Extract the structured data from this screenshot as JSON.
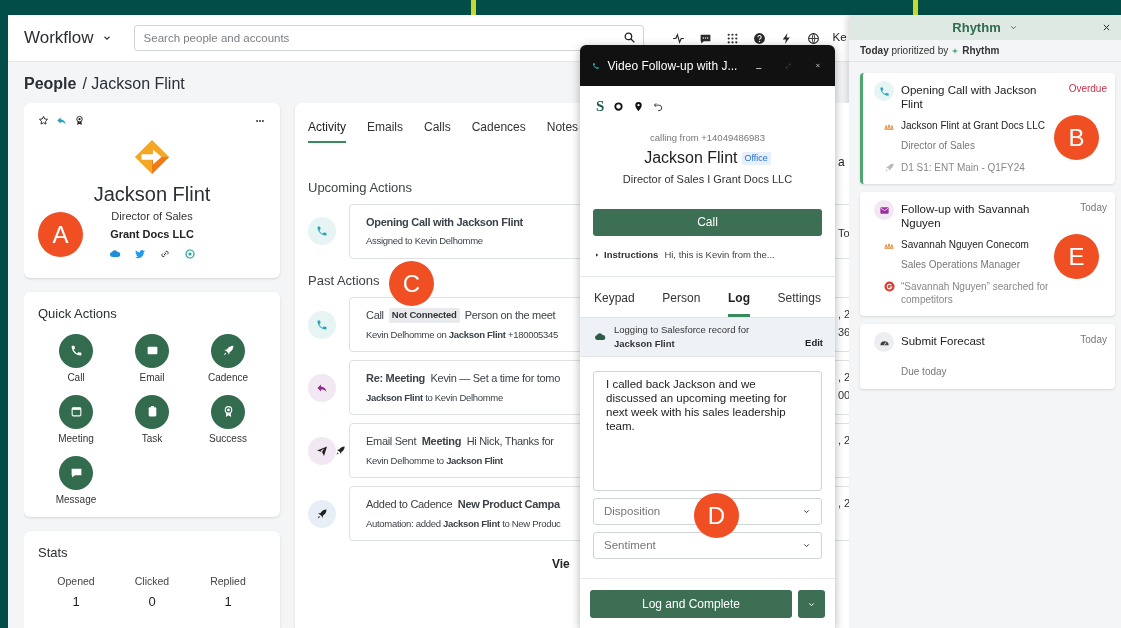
{
  "app": {
    "menu": "Workflow",
    "search": {
      "placeholder": "Search people and accounts"
    },
    "user_fragment": "Ke"
  },
  "breadcrumb": {
    "section": "People",
    "current": "/ Jackson Flint"
  },
  "profile": {
    "name": "Jackson Flint",
    "title": "Director of Sales",
    "company": "Grant Docs LLC"
  },
  "quick_actions": {
    "title": "Quick Actions",
    "items": [
      {
        "label": "Call",
        "kind": "call"
      },
      {
        "label": "Email",
        "kind": "email"
      },
      {
        "label": "Cadence",
        "kind": "cadence"
      },
      {
        "label": "Meeting",
        "kind": "meeting"
      },
      {
        "label": "Task",
        "kind": "task"
      },
      {
        "label": "Success",
        "kind": "success"
      },
      {
        "label": "Message",
        "kind": "message"
      }
    ]
  },
  "stats": {
    "title": "Stats",
    "items": [
      {
        "label": "Opened",
        "value": "1"
      },
      {
        "label": "Clicked",
        "value": "0"
      },
      {
        "label": "Replied",
        "value": "1"
      }
    ]
  },
  "activity": {
    "tabs": [
      {
        "label": "Activity",
        "selected": true
      },
      {
        "label": "Emails",
        "selected": false
      },
      {
        "label": "Calls",
        "selected": false
      },
      {
        "label": "Cadences",
        "selected": false
      },
      {
        "label": "Notes",
        "selected": false
      }
    ],
    "header_fragment": "a",
    "upcoming_title": "Upcoming Actions",
    "upcoming": [
      {
        "kind": "call",
        "line1": "**Opening Call with Jackson Flint**",
        "line2": "Assigned to Kevin Delhomme",
        "fragments": [
          "To"
        ]
      }
    ],
    "past_title": "Past Actions",
    "past": [
      {
        "kind": "call",
        "line1": "Call",
        "tag": "Not Connected",
        "line1_rest": "Person on the meet",
        "line2": "Kevin Delhomme on **Jackson Flint** +180005345",
        "fragments": [
          ", 2",
          "36"
        ]
      },
      {
        "kind": "reply",
        "line1": "**Re: Meeting**  Kevin — Set a time for tomo",
        "line2": "**Jackson Flint** to Kevin Delhomme",
        "fragments": [
          ", 2",
          "00"
        ]
      },
      {
        "kind": "email",
        "line1": "Email Sent  **Meeting**  Hi Nick, Thanks for",
        "line2": "Kevin Delhomme to **Jackson Flint**",
        "fragments": [
          ", 2"
        ]
      },
      {
        "kind": "cadence",
        "line1": "Added to Cadence  **New Product Campa**",
        "line2": "Automation: added **Jackson Flint** to New Produc",
        "fragments": [
          ", 2"
        ]
      }
    ],
    "more": "Vie"
  },
  "dialog": {
    "title": "Video Follow-up with J...",
    "logo_letter": "S",
    "calling_from": "calling from +14049486983",
    "name": "Jackson Flint",
    "badge": "Office",
    "subtitle": "Director of Sales I Grant Docs LLC",
    "call_button": "Call",
    "instructions_label": "Instructions",
    "instructions_text": "Hi, this is Kevin from the...",
    "tabs": [
      {
        "label": "Keypad",
        "selected": false
      },
      {
        "label": "Person",
        "selected": false
      },
      {
        "label": "Log",
        "selected": true
      },
      {
        "label": "Settings",
        "selected": false
      }
    ],
    "logging": {
      "line1": "Logging to Salesforce record for",
      "line2": "Jackson Flint",
      "action": "Edit"
    },
    "notes": "I called back Jackson and we discussed an upcoming meeting for next week with his sales leadership team.",
    "selects": [
      {
        "placeholder": "Disposition"
      },
      {
        "placeholder": "Sentiment"
      }
    ],
    "submit": "Log and Complete"
  },
  "rhythm": {
    "title": "Rhythm",
    "subtitle": "**Today** prioritized by",
    "subtitle_brand": "Rhythm",
    "cards": [
      {
        "kind": "call",
        "title": "Opening Call with Jackson Flint",
        "due": "Overdue",
        "overdue": true,
        "selected": true,
        "contact": "Jackson Flint at Grant Docs LLC",
        "detail": "Director of Sales",
        "note": {
          "kind": "cadence",
          "text": "D1 S1: ENT Main - Q1FY24"
        }
      },
      {
        "kind": "email",
        "title": "Follow-up with Savannah Nguyen",
        "due": "Today",
        "overdue": false,
        "selected": false,
        "contact": "Savannah Nguyen Conecom",
        "detail": "Sales Operations Manager",
        "note": {
          "kind": "intent",
          "text": "“Savannah Nguyen” searched for competitors"
        }
      },
      {
        "kind": "forecast",
        "title": "Submit Forecast",
        "due": "Today",
        "overdue": false,
        "selected": false,
        "detail": "Due today"
      }
    ]
  },
  "callouts": [
    {
      "label": "A"
    },
    {
      "label": "B"
    },
    {
      "label": "C"
    },
    {
      "label": "D"
    },
    {
      "label": "E"
    }
  ]
}
